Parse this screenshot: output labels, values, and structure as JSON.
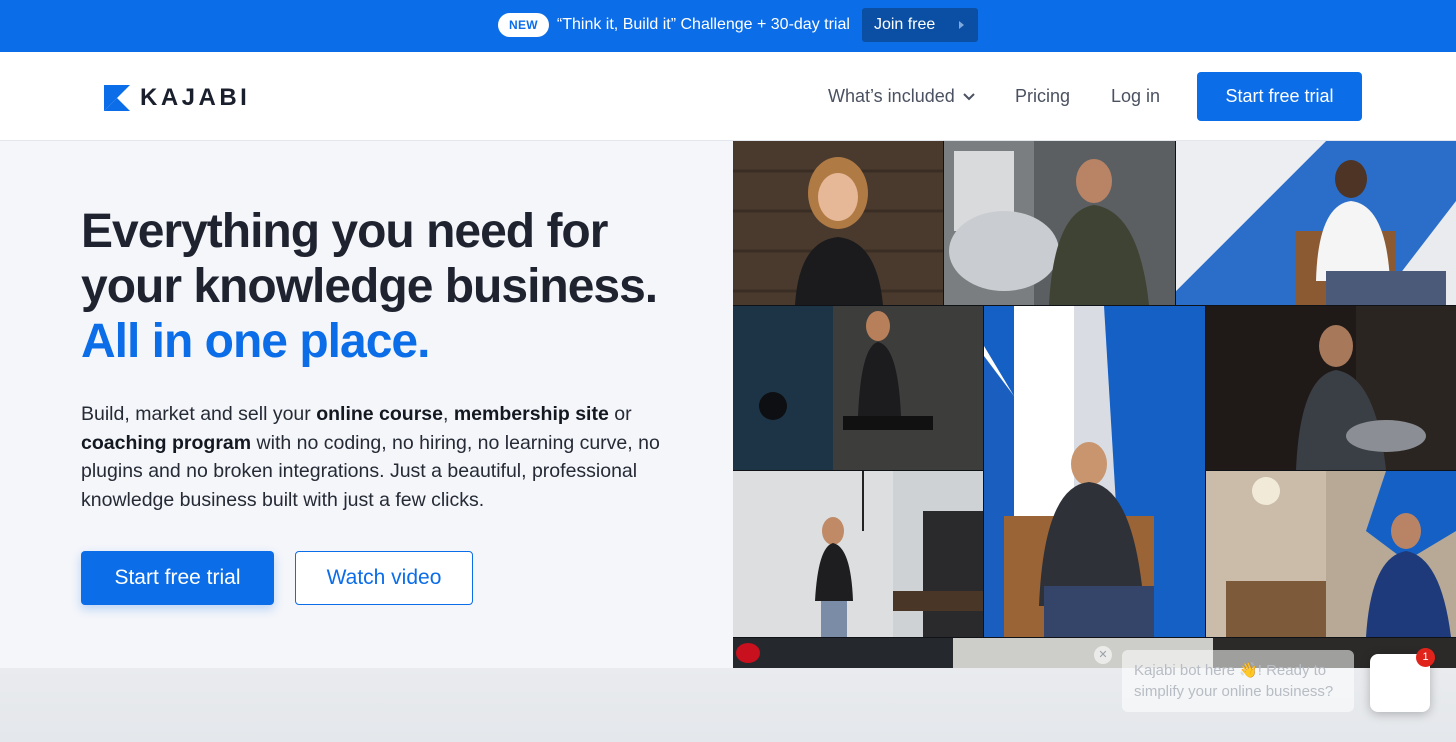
{
  "announcement": {
    "badge": "NEW",
    "text": "“Think it, Build it” Challenge + 30-day trial",
    "cta": "Join free"
  },
  "header": {
    "logo_text": "KAJABI",
    "nav": {
      "whats_included": "What’s included",
      "pricing": "Pricing",
      "login": "Log in"
    },
    "cta": "Start free trial"
  },
  "hero": {
    "headline_line1": "Everything you need for",
    "headline_line2": "your knowledge business.",
    "headline_accent": "All in one place.",
    "desc": {
      "p1": "Build, market and sell your ",
      "b1": "online course",
      "p2": ", ",
      "b2": "membership site",
      "p3": " or ",
      "b3": "coaching program",
      "p4": " with no coding, no hiring, no learning curve, no plugins and no broken integrations. Just a beautiful, professional knowledge business built with just a few clicks."
    },
    "primary_cta": "Start free trial",
    "secondary_cta": "Watch video"
  },
  "chat": {
    "message": "Kajabi bot here 👋! Ready to simplify your online business?",
    "badge_count": "1"
  },
  "colors": {
    "brand_blue": "#0c6de8",
    "hero_bg": "#f4f6fa",
    "dark_text": "#1f2330"
  }
}
